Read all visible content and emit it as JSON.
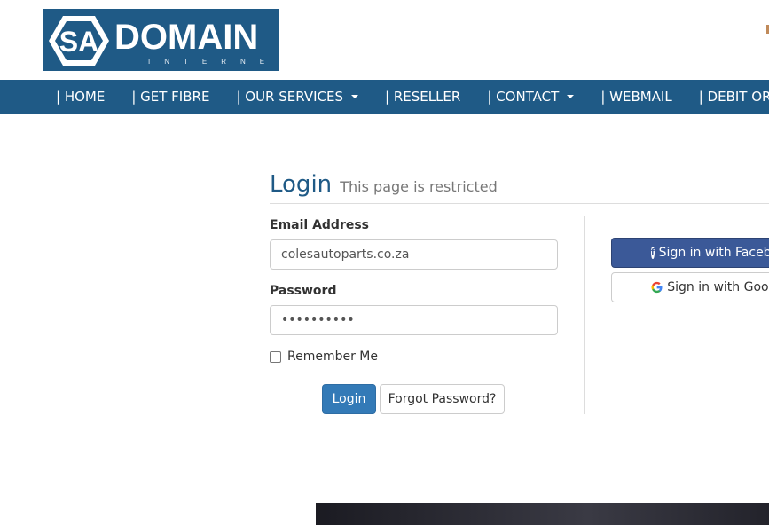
{
  "logo": {
    "brand_short": "SA",
    "brand_name": "DOMAIN",
    "tagline": "INTERNET"
  },
  "nav": {
    "items": [
      {
        "label": "| HOME",
        "has_dropdown": false
      },
      {
        "label": "| GET FIBRE",
        "has_dropdown": false
      },
      {
        "label": "| OUR SERVICES",
        "has_dropdown": true
      },
      {
        "label": "| RESELLER",
        "has_dropdown": false
      },
      {
        "label": "| CONTACT",
        "has_dropdown": true
      },
      {
        "label": "| WEBMAIL",
        "has_dropdown": false
      },
      {
        "label": "| DEBIT ORDER",
        "has_dropdown": false
      }
    ]
  },
  "login": {
    "title": "Login",
    "subtitle": "This page is restricted",
    "email_label": "Email Address",
    "email_value": "colesautoparts.co.za",
    "password_label": "Password",
    "password_value": "••••••••••",
    "remember_label": "Remember Me",
    "login_button": "Login",
    "forgot_button": "Forgot Password?"
  },
  "social": {
    "facebook_label": "Sign in with Facebook",
    "google_label": "Sign in with Google"
  },
  "colors": {
    "brand_blue": "#1f5a86",
    "button_blue": "#337ab7",
    "facebook_blue": "#3b5998"
  }
}
